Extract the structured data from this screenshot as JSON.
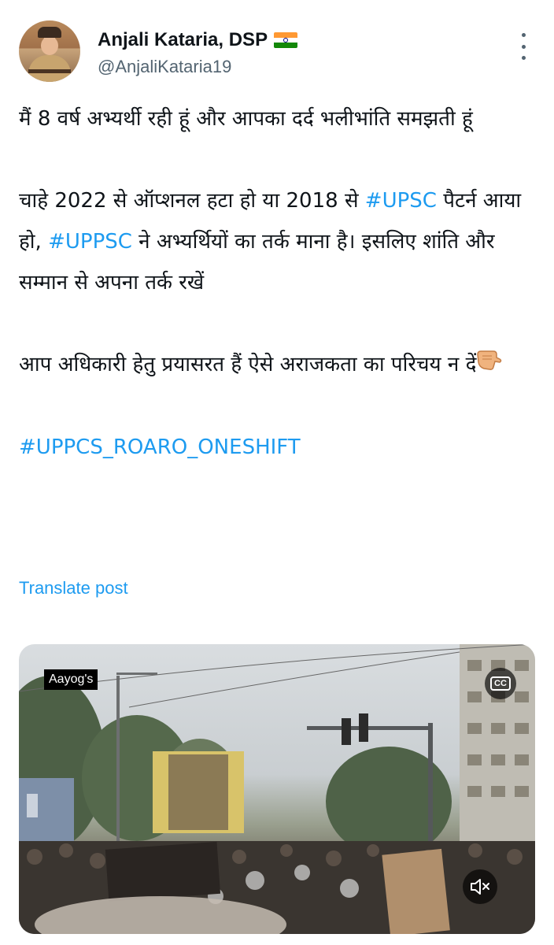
{
  "user": {
    "name": "Anjali Kataria, DSP",
    "handle": "@AnjaliKataria19",
    "flag_icon": "india-flag-icon"
  },
  "post": {
    "line1": "मैं 8 वर्ष अभ्यर्थी रही हूं और आपका दर्द भलीभांति समझती हूं",
    "line2_pre": "चाहे 2022 से ऑप्शनल हटा हो या 2018 से ",
    "hashtag_upsc": "#UPSC",
    "line2_mid": " पैटर्न आया हो, ",
    "hashtag_uppsc": "#UPPSC",
    "line2_post": " ने अभ्यर्थियों का तर्क माना है। इसलिए शांति और सम्मान से अपना तर्क रखें",
    "line3": "आप अधिकारी हेतु प्रयासरत हैं ऐसे अराजकता का परिचय न दें",
    "emoji_icon": "pointing-down-hand-icon",
    "hashtag_main": "#UPPCS_ROARO_ONESHIFT"
  },
  "translate_label": "Translate post",
  "media": {
    "tag_label": "Aayog's",
    "cc_label": "CC"
  },
  "colors": {
    "link": "#1d9bf0",
    "text": "#0f1419",
    "secondary": "#536471"
  }
}
